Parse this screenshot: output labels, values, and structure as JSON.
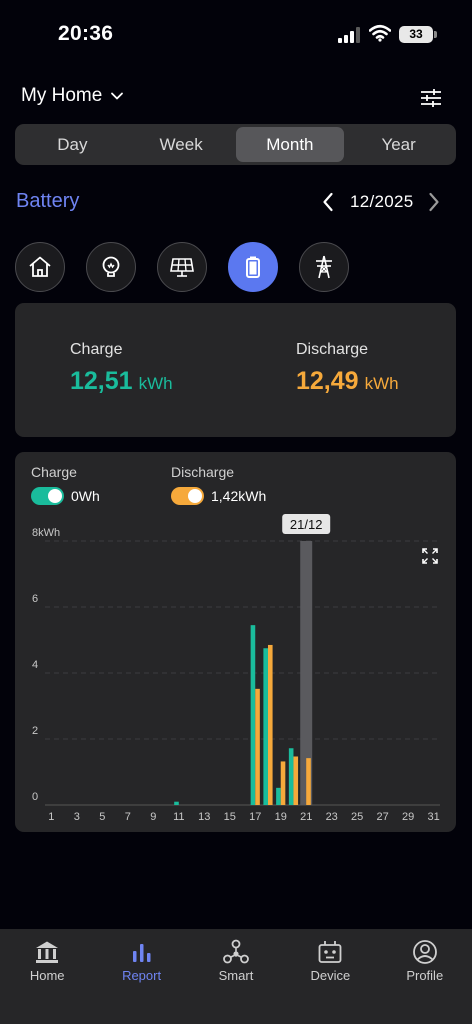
{
  "status": {
    "time": "20:36",
    "battery": "33"
  },
  "header": {
    "home_label": "My Home"
  },
  "period_tabs": [
    {
      "label": "Day",
      "active": false
    },
    {
      "label": "Week",
      "active": false
    },
    {
      "label": "Month",
      "active": true
    },
    {
      "label": "Year",
      "active": false
    }
  ],
  "section": {
    "title": "Battery",
    "date": "12/2025"
  },
  "categories": [
    "home",
    "consumption",
    "solar",
    "battery",
    "grid"
  ],
  "active_category": "battery",
  "summary": {
    "charge": {
      "label": "Charge",
      "value": "12,51",
      "unit": "kWh",
      "color": "#1abc9c"
    },
    "discharge": {
      "label": "Discharge",
      "value": "12,49",
      "unit": "kWh",
      "color": "#f6a93b"
    }
  },
  "legend": {
    "charge": {
      "label": "Charge",
      "value": "0Wh",
      "enabled": true
    },
    "discharge": {
      "label": "Discharge",
      "value": "1,42kWh",
      "enabled": true
    }
  },
  "chart_data": {
    "type": "bar",
    "tooltip": "21/12",
    "selected_day": 21,
    "y_unit": "kWh",
    "ylim": [
      0,
      8
    ],
    "y_ticks": [
      "0",
      "2",
      "4",
      "6",
      "8kWh"
    ],
    "x_ticks": [
      "1",
      "3",
      "5",
      "7",
      "9",
      "11",
      "13",
      "15",
      "17",
      "19",
      "21",
      "23",
      "25",
      "27",
      "29",
      "31"
    ],
    "days": [
      1,
      2,
      3,
      4,
      5,
      6,
      7,
      8,
      9,
      10,
      11,
      12,
      13,
      14,
      15,
      16,
      17,
      18,
      19,
      20,
      21,
      22,
      23,
      24,
      25,
      26,
      27,
      28,
      29,
      30,
      31
    ],
    "series": [
      {
        "name": "Charge",
        "color": "#1abc9c",
        "values": [
          0,
          0,
          0,
          0,
          0,
          0,
          0,
          0,
          0,
          0,
          0.1,
          0,
          0,
          0,
          0,
          0,
          5.45,
          4.75,
          0.52,
          1.72,
          0,
          0,
          0,
          0,
          0,
          0,
          0,
          0,
          0,
          0,
          0
        ]
      },
      {
        "name": "Discharge",
        "color": "#f6a93b",
        "values": [
          0,
          0,
          0,
          0,
          0,
          0,
          0,
          0,
          0,
          0,
          0,
          0,
          0,
          0,
          0,
          0,
          3.52,
          4.85,
          1.32,
          1.47,
          1.42,
          0,
          0,
          0,
          0,
          0,
          0,
          0,
          0,
          0,
          0
        ]
      }
    ]
  },
  "tabbar": [
    {
      "label": "Home",
      "icon": "home-icon",
      "active": false
    },
    {
      "label": "Report",
      "icon": "report-icon",
      "active": true
    },
    {
      "label": "Smart",
      "icon": "smart-icon",
      "active": false
    },
    {
      "label": "Device",
      "icon": "device-icon",
      "active": false
    },
    {
      "label": "Profile",
      "icon": "profile-icon",
      "active": false
    }
  ]
}
